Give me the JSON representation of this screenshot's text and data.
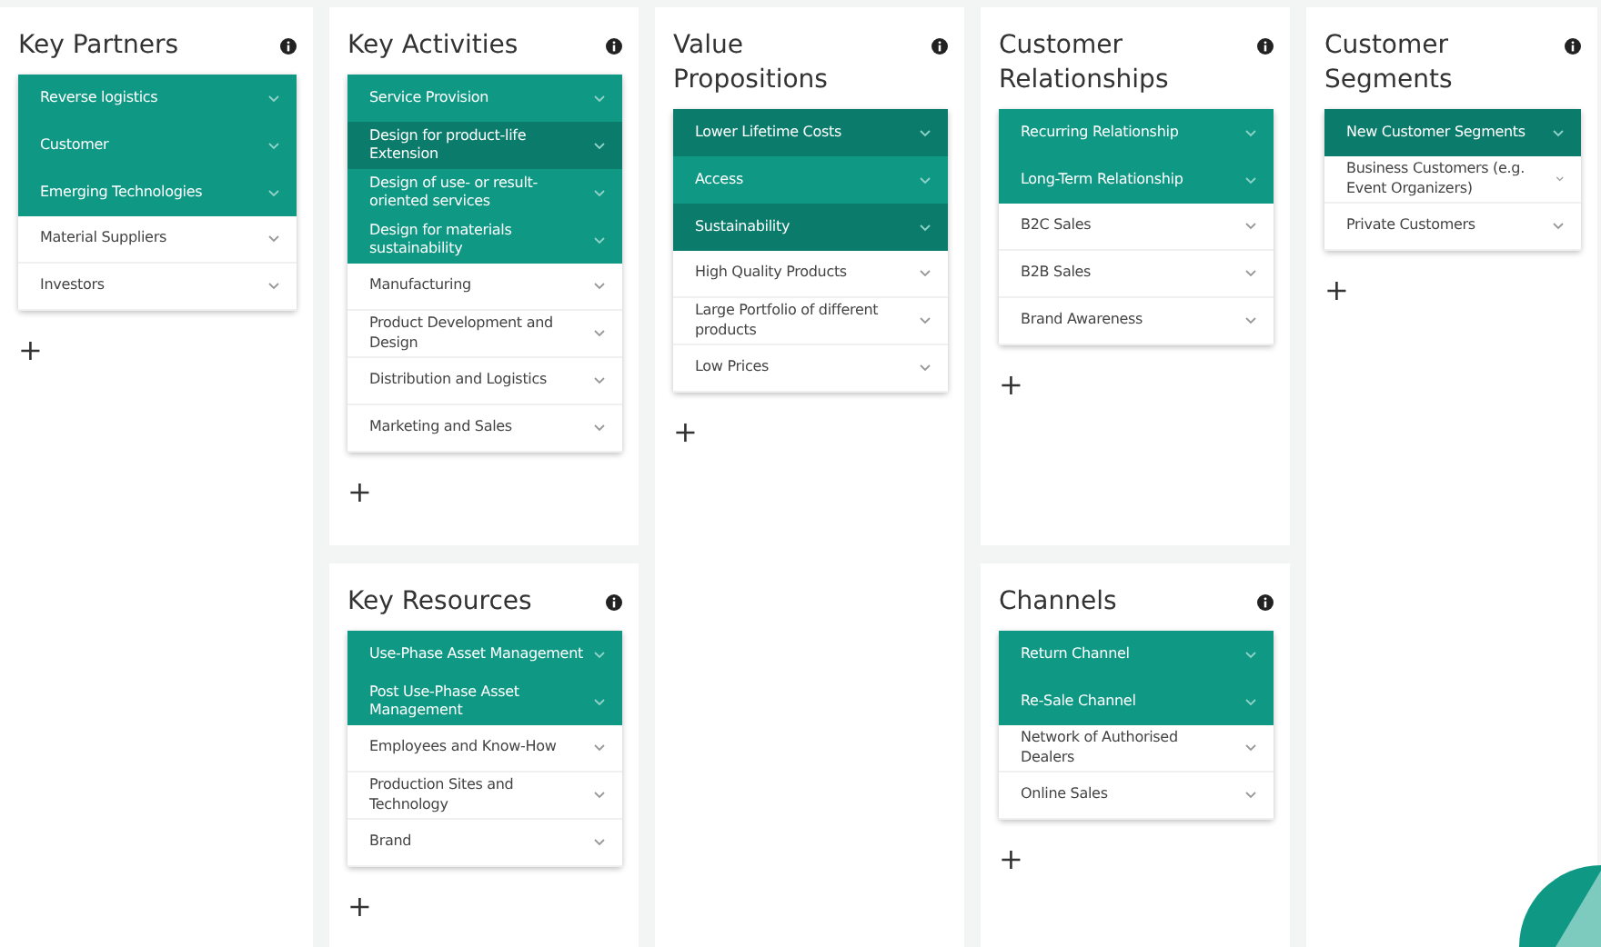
{
  "columns": [
    {
      "blocks": [
        {
          "title": "Key Partners",
          "items": [
            {
              "label": "Reverse logistics",
              "active": true,
              "emphasized": false
            },
            {
              "label": "Customer",
              "active": true,
              "emphasized": false
            },
            {
              "label": "Emerging Technologies",
              "active": true,
              "emphasized": false
            },
            {
              "label": "Material Suppliers",
              "active": false,
              "emphasized": false
            },
            {
              "label": "Investors",
              "active": false,
              "emphasized": false
            }
          ],
          "add": "+"
        }
      ]
    },
    {
      "blocks": [
        {
          "title": "Key Activities",
          "items": [
            {
              "label": "Service Provision",
              "active": true,
              "emphasized": false
            },
            {
              "label": "Design for product-life Extension",
              "active": true,
              "emphasized": true
            },
            {
              "label": "Design of use- or result-oriented services",
              "active": true,
              "emphasized": false
            },
            {
              "label": "Design for materials sustainability",
              "active": true,
              "emphasized": false
            },
            {
              "label": "Manufacturing",
              "active": false,
              "emphasized": false
            },
            {
              "label": "Product Development and Design",
              "active": false,
              "emphasized": false
            },
            {
              "label": "Distribution and Logistics",
              "active": false,
              "emphasized": false
            },
            {
              "label": "Marketing and Sales",
              "active": false,
              "emphasized": false
            }
          ],
          "add": "+"
        },
        {
          "title": "Key Resources",
          "items": [
            {
              "label": "Use-Phase Asset Management",
              "active": true,
              "emphasized": false
            },
            {
              "label": "Post Use-Phase Asset Management",
              "active": true,
              "emphasized": false
            },
            {
              "label": "Employees and Know-How",
              "active": false,
              "emphasized": false
            },
            {
              "label": "Production Sites and Technology",
              "active": false,
              "emphasized": false
            },
            {
              "label": "Brand",
              "active": false,
              "emphasized": false
            }
          ],
          "add": "+"
        }
      ]
    },
    {
      "blocks": [
        {
          "title": "Value Propositions",
          "items": [
            {
              "label": "Lower Lifetime Costs",
              "active": true,
              "emphasized": true
            },
            {
              "label": "Access",
              "active": true,
              "emphasized": false
            },
            {
              "label": "Sustainability",
              "active": true,
              "emphasized": true
            },
            {
              "label": "High Quality Products",
              "active": false,
              "emphasized": false
            },
            {
              "label": "Large Portfolio of different products",
              "active": false,
              "emphasized": false
            },
            {
              "label": "Low Prices",
              "active": false,
              "emphasized": false
            }
          ],
          "add": "+"
        }
      ]
    },
    {
      "blocks": [
        {
          "title": "Customer Relationships",
          "items": [
            {
              "label": "Recurring Relationship",
              "active": true,
              "emphasized": false
            },
            {
              "label": "Long-Term Relationship",
              "active": true,
              "emphasized": false
            },
            {
              "label": "B2C Sales",
              "active": false,
              "emphasized": false
            },
            {
              "label": "B2B Sales",
              "active": false,
              "emphasized": false
            },
            {
              "label": "Brand Awareness",
              "active": false,
              "emphasized": false
            }
          ],
          "add": "+"
        },
        {
          "title": "Channels",
          "items": [
            {
              "label": "Return Channel",
              "active": true,
              "emphasized": false
            },
            {
              "label": "Re-Sale Channel",
              "active": true,
              "emphasized": false
            },
            {
              "label": "Network of Authorised Dealers",
              "active": false,
              "emphasized": false
            },
            {
              "label": "Online Sales",
              "active": false,
              "emphasized": false
            }
          ],
          "add": "+"
        }
      ]
    },
    {
      "blocks": [
        {
          "title": "Customer Segments",
          "items": [
            {
              "label": "New Customer Segments",
              "active": true,
              "emphasized": true
            },
            {
              "label": "Business Customers (e.g. Event Organizers)",
              "active": false,
              "emphasized": false
            },
            {
              "label": "Private Customers",
              "active": false,
              "emphasized": false
            }
          ],
          "add": "+"
        }
      ]
    }
  ]
}
